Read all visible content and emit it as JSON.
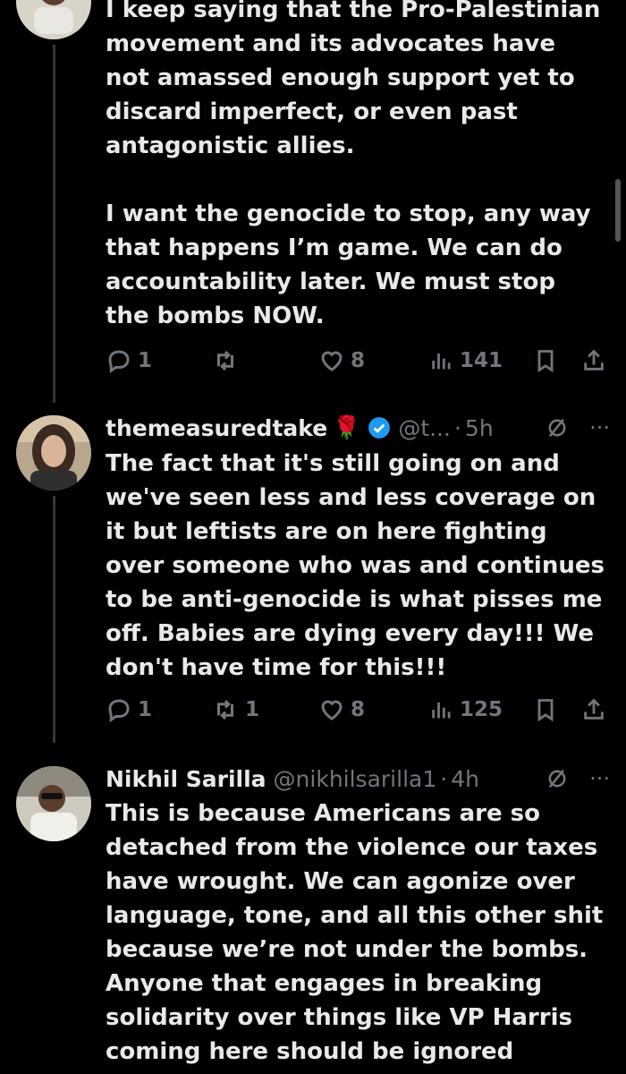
{
  "tweets": [
    {
      "body": "I keep saying that the Pro-Palestinian movement and its advocates have not amassed enough support yet to discard imperfect, or even past antagonistic allies.\n\nI want the genocide to stop, any way that happens I’m game. We can do accountability later. We must stop the bombs NOW.",
      "replies": "1",
      "retweets": "",
      "likes": "8",
      "views": "141"
    },
    {
      "name": "themeasuredtake",
      "emoji": "🌹",
      "handle": "@t...",
      "time": "5h",
      "body": "The fact that it's still going on and we've seen less and less coverage on it but leftists are on here fighting over someone who was and continues to be anti-genocide is what pisses me off. Babies are dying every day!!! We don't have time for this!!!",
      "replies": "1",
      "retweets": "1",
      "likes": "8",
      "views": "125"
    },
    {
      "name": "Nikhil Sarilla",
      "handle": "@nikhilsarilla1",
      "time": "4h",
      "body": "This is because Americans are so detached from the violence our taxes have wrought. We can agonize over language, tone, and all this other shit because we’re not under the bombs. Anyone that engages in breaking solidarity over things like VP Harris coming here should be ignored"
    }
  ],
  "separator": "·",
  "more": "···",
  "colors": {
    "background": "#000000",
    "text": "#e7e9ea",
    "muted": "#71767b",
    "verified": "#1d9bf0"
  }
}
